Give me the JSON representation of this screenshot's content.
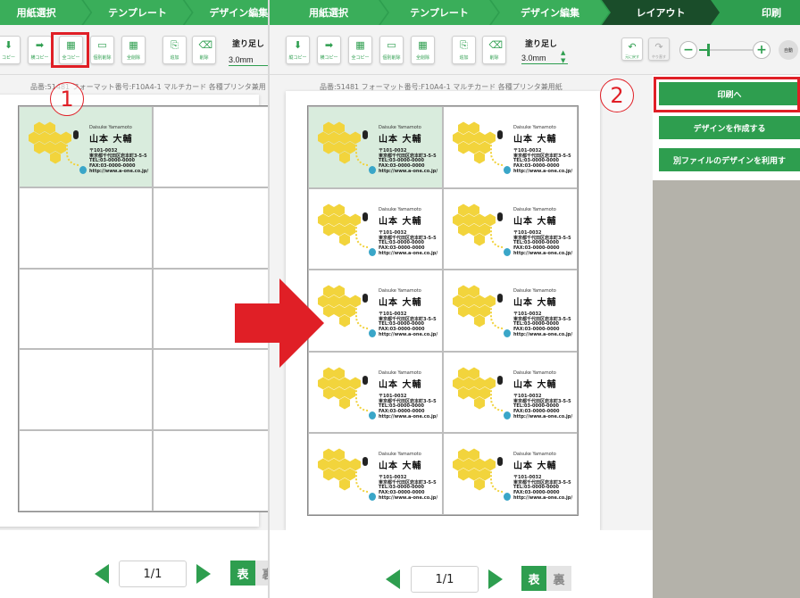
{
  "steps": {
    "left": [
      {
        "label": "用紙選択",
        "state": "done"
      },
      {
        "label": "テンプレート",
        "state": "done"
      },
      {
        "label": "デザイン編集",
        "state": "done"
      }
    ],
    "right": [
      {
        "label": "用紙選択",
        "state": "done"
      },
      {
        "label": "テンプレート",
        "state": "done"
      },
      {
        "label": "デザイン編集",
        "state": "done"
      },
      {
        "label": "レイアウト",
        "state": "active"
      },
      {
        "label": "印刷",
        "state": "pending"
      }
    ]
  },
  "toolbar": {
    "left_buttons": [
      {
        "label": "コピー",
        "icon": "arrow-down-icon"
      },
      {
        "label": "横コピー",
        "icon": "arrow-right-icon"
      },
      {
        "label": "全コピー",
        "icon": "grid-icon"
      },
      {
        "label": "個別削除",
        "icon": "single-delete-icon"
      },
      {
        "label": "全削除",
        "icon": "all-delete-icon"
      },
      {
        "label": "追加",
        "icon": "add-page-icon"
      },
      {
        "label": "削除",
        "icon": "delete-page-icon"
      }
    ],
    "right_buttons": [
      {
        "label": "縦コピー",
        "icon": "arrow-down-icon"
      },
      {
        "label": "横コピー",
        "icon": "arrow-right-icon"
      },
      {
        "label": "全コピー",
        "icon": "grid-icon"
      },
      {
        "label": "個別削除",
        "icon": "single-delete-icon"
      },
      {
        "label": "全削除",
        "icon": "all-delete-icon"
      },
      {
        "label": "追加",
        "icon": "add-page-icon"
      },
      {
        "label": "削除",
        "icon": "delete-page-icon"
      }
    ],
    "bleed_label": "塗り足し",
    "bleed_value": "3.0mm",
    "undo_label": "元に戻す",
    "redo_label": "やり直す",
    "auto_label": "自動"
  },
  "zoom": {
    "level_fraction": 0.16
  },
  "product_info": "品番:51481 フォーマット番号:F10A4-1 マルチカード 各種プリンタ兼用紙",
  "product_info_left": "品番:51481 フォーマット番号:F10A4-1 マルチカード 各種プリンタ兼用",
  "card": {
    "latin_name": "Daisuke Yamamoto",
    "name": "山本 大輔",
    "postal": "〒101-0032",
    "address": "東京都千代田区岩本町3-5-5",
    "tel": "TEL:03-0000-0000",
    "fax": "FAX:03-0000-0000",
    "url": "http://www.a-one.co.jp/"
  },
  "pager": {
    "page": "1/1",
    "front_label": "表",
    "back_label": "裏"
  },
  "actions": {
    "print": "印刷へ",
    "create": "デザインを作成する",
    "use_other": "別ファイルのデザインを利用す"
  },
  "annotations": {
    "step1": "1",
    "step2": "2"
  },
  "colors": {
    "brand_green": "#2e9e4f",
    "active_step": "#1a4d2a",
    "selected_cell": "#d9ecdd",
    "annotation_red": "#e01f26",
    "gray_area": "#b4b2aa"
  }
}
